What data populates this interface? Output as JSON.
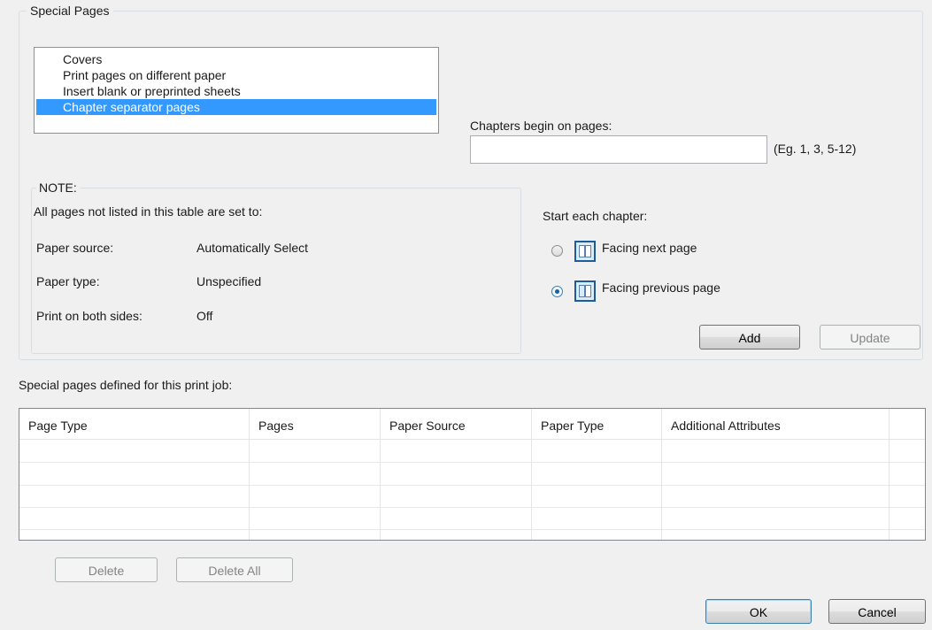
{
  "special_pages": {
    "group_title": "Special Pages",
    "list_items": [
      {
        "label": "Covers"
      },
      {
        "label": "Print pages on different paper"
      },
      {
        "label": "Insert blank or preprinted sheets"
      },
      {
        "label": "Chapter separator pages",
        "selected": true
      }
    ],
    "chapters_label": "Chapters begin on pages:",
    "chapters_value": "",
    "chapters_hint": "(Eg. 1, 3, 5-12)",
    "note": {
      "title": "NOTE:",
      "subtitle": "All pages not listed in this table are set to:",
      "rows": [
        {
          "label": "Paper source:",
          "value": "Automatically Select"
        },
        {
          "label": "Paper type:",
          "value": "Unspecified"
        },
        {
          "label": "Print on both sides:",
          "value": "Off"
        }
      ]
    },
    "start_chapter_label": "Start each chapter:",
    "radio_next": "Facing next page",
    "radio_previous": "Facing previous page",
    "selected_radio": "previous",
    "add_button": "Add",
    "update_button": "Update"
  },
  "defined": {
    "label": "Special pages defined for this print job:",
    "columns": [
      "Page Type",
      "Pages",
      "Paper Source",
      "Paper Type",
      "Additional Attributes"
    ],
    "rows": []
  },
  "buttons": {
    "delete": "Delete",
    "delete_all": "Delete All",
    "ok": "OK",
    "cancel": "Cancel"
  }
}
